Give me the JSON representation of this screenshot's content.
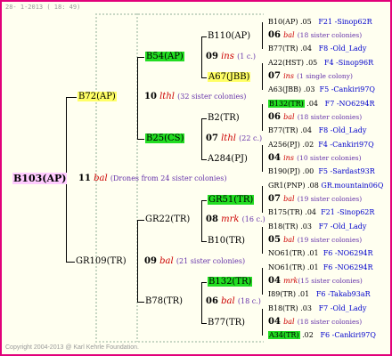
{
  "header": {
    "date_text": "28- 1-2013 ( 18: 49)"
  },
  "footer": {
    "copyright": "Copyright 2004-2013 @ Karl Kehrle Foundation."
  },
  "colors": {
    "border": "#e2007a",
    "yellow_highlight": "#ffff66",
    "green_highlight": "#22dd22",
    "pink_highlight": "#ffccff",
    "italic_red": "#cc0000",
    "link_blue": "#0000cc",
    "note_purple": "#6633aa"
  },
  "root": {
    "id": "B103(AP)"
  },
  "generation1": {
    "num": "11",
    "tag": "bal",
    "note": "(Drones from 24 sister colonies)"
  },
  "upper": {
    "queen": "B72(AP)",
    "num": "10",
    "tag": "lthl",
    "note": "(32 sister colonies)",
    "a": {
      "queen": "B54(AP)",
      "num": "09",
      "tag": "ins",
      "note": "(1 c.)",
      "top": "B110(AP)",
      "bottom": "A67(JBB)"
    },
    "b": {
      "queen": "B25(CS)",
      "num": "07",
      "tag": "lthl",
      "note": "(22 c.)",
      "top": "B2(TR)",
      "bottom": "A284(PJ)"
    }
  },
  "lower": {
    "queen": "GR109(TR)",
    "num": "09",
    "tag": "bal",
    "note": "(21 sister colonies)",
    "a": {
      "queen": "GR22(TR)",
      "num": "08",
      "tag": "mrk",
      "note": "(16 c.)",
      "top": "GR51(TR)",
      "bottom": "B10(TR)"
    },
    "b": {
      "queen": "B78(TR)",
      "num": "06",
      "tag": "bal",
      "note": "(18 c.)",
      "top": "B132(TR)",
      "bottom": "B77(TR)"
    }
  },
  "right": [
    {
      "id": "B10(AP)",
      "sep": " .05",
      "ref": "F21 -Sinop62R"
    },
    {
      "num": "06",
      "tag": "bal",
      "note": "(18 sister colonies)"
    },
    {
      "id": "B77(TR)",
      "sep": " .04",
      "ref": "F8 -Old_Lady"
    },
    {
      "id": "A22(HST)",
      "sep": " .05",
      "ref": "F4 -Sinop96R"
    },
    {
      "num": "07",
      "tag": "ins",
      "note": "(1 single colony)"
    },
    {
      "id": "A63(JBB)",
      "sep": " .03",
      "ref": "F5 -Cankiri97Q"
    },
    {
      "id": "B132(TR)",
      "sep": " .04",
      "ref": "F7 -NO6294R"
    },
    {
      "num": "06",
      "tag": "bal",
      "note": "(18 sister colonies)"
    },
    {
      "id": "B77(TR)",
      "sep": " .04",
      "ref": "F8 -Old_Lady"
    },
    {
      "id": "A256(PJ)",
      "sep": " .02",
      "ref": "F4 -Cankiri97Q"
    },
    {
      "num": "04",
      "tag": "ins",
      "note": "(10 sister colonies)"
    },
    {
      "id": "B190(PJ)",
      "sep": " .00",
      "ref": "F5 -Sardast93R"
    },
    {
      "id": "GR1(PNP)",
      "sep": " .08",
      "ref": "GR.mountain06Q"
    },
    {
      "num": "07",
      "tag": "bal",
      "note": "(19 sister colonies)"
    },
    {
      "id": "B175(TR)",
      "sep": " .04",
      "ref": "F21 -Sinop62R"
    },
    {
      "id": "B18(TR)",
      "sep": " .03",
      "ref": "F7 -Old_Lady"
    },
    {
      "num": "05",
      "tag": "bal",
      "note": "(19 sister colonies)"
    },
    {
      "id": "NO61(TR)",
      "sep": " .01",
      "ref": "F6 -NO6294R"
    },
    {
      "id": "NO61(TR)",
      "sep": " .01",
      "ref": "F6 -NO6294R"
    },
    {
      "num": "04",
      "tag": "mrk",
      "note": "(15 sister colonies)"
    },
    {
      "id": "I89(TR)",
      "sep": " .01",
      "ref": "F6 -Takab93aR"
    },
    {
      "id": "B18(TR)",
      "sep": " .03",
      "ref": "F7 -Old_Lady"
    },
    {
      "num": "04",
      "tag": "bal",
      "note": "(18 sister colonies)"
    },
    {
      "id": "A34(TR)",
      "sep": " .02",
      "ref": "F6 -Cankiri97Q"
    }
  ]
}
